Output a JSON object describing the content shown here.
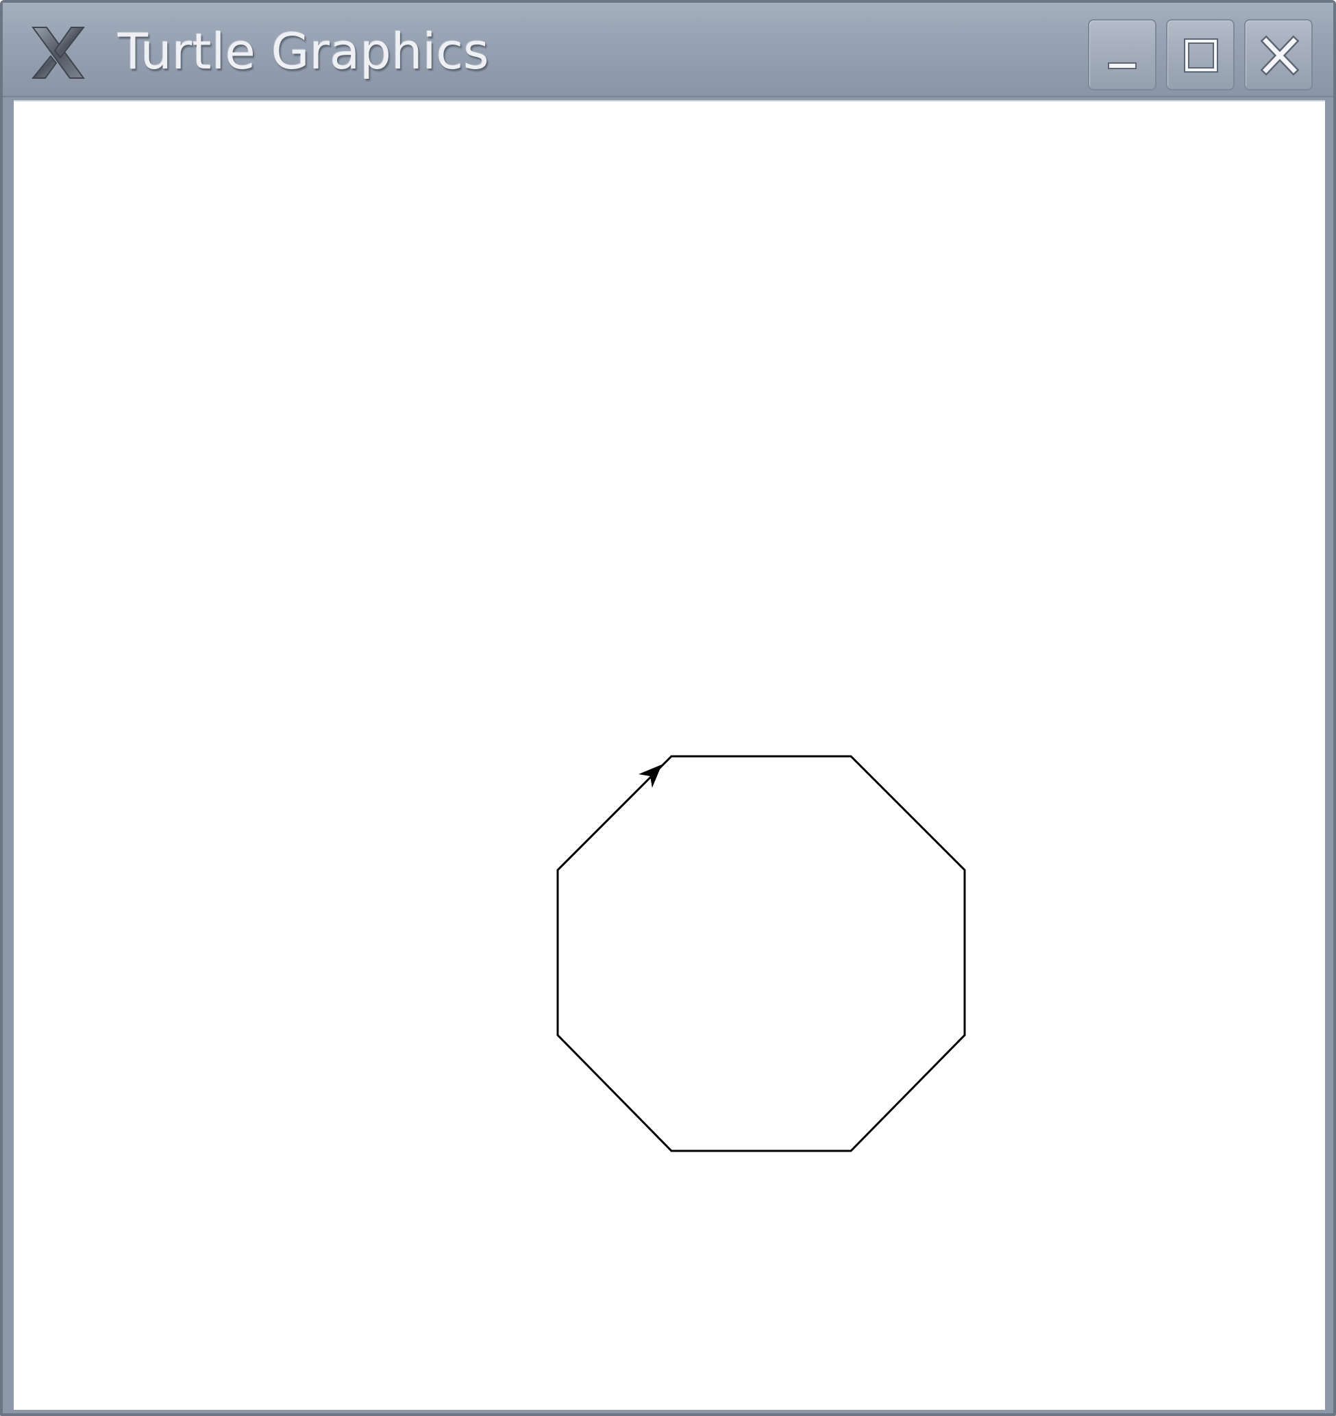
{
  "window": {
    "title": "Turtle Graphics",
    "app_icon": "x-logo-icon",
    "controls": {
      "minimize_icon": "minimize-icon",
      "maximize_icon": "maximize-icon",
      "close_icon": "close-icon"
    }
  },
  "canvas": {
    "background": "#ffffff",
    "drawing": {
      "shape": "octagon",
      "sides": 8,
      "stroke_color": "#000000"
    },
    "turtle": {
      "icon": "turtle-arrow-icon",
      "color": "#000000"
    }
  },
  "colors": {
    "titlebar": "#96a1b1",
    "frame": "#6b7584",
    "title_text": "#eef0f3"
  }
}
